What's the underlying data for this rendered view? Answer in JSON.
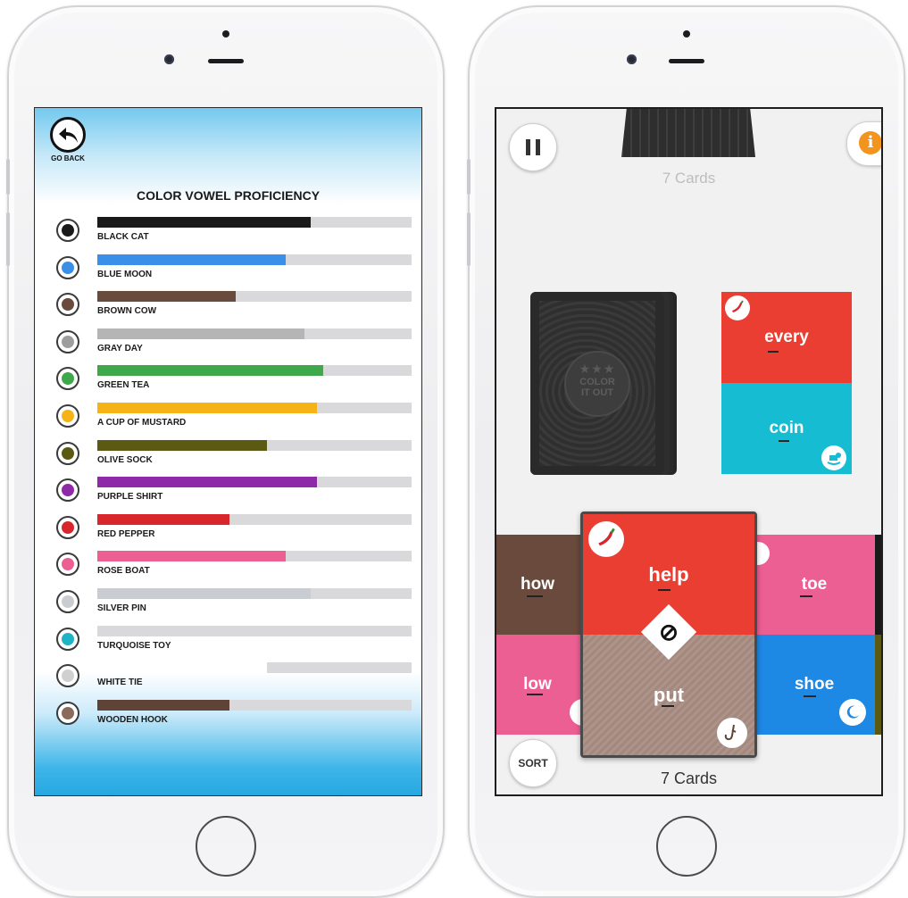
{
  "left_screen": {
    "go_back_label": "GO BACK",
    "title": "COLOR VOWEL PROFICIENCY",
    "rows": [
      {
        "label": "BLACK CAT",
        "color": "#1a1a1a",
        "icon_color": "#1a1a1a",
        "progress": 0.68,
        "icon": "cat-icon"
      },
      {
        "label": "BLUE MOON",
        "color": "#3a8fe8",
        "icon_color": "#3a8fe8",
        "progress": 0.6,
        "icon": "moon-icon"
      },
      {
        "label": "BROWN COW",
        "color": "#6a4a3c",
        "icon_color": "#6a4a3c",
        "progress": 0.44,
        "icon": "cow-icon"
      },
      {
        "label": "GRAY DAY",
        "color": "#b5b5b5",
        "icon_color": "#9e9e9e",
        "progress": 0.66,
        "icon": "cloud-icon"
      },
      {
        "label": "GREEN TEA",
        "color": "#3ea84a",
        "icon_color": "#3ea84a",
        "progress": 0.72,
        "icon": "teacup-icon"
      },
      {
        "label": "A CUP OF MUSTARD",
        "color": "#f5b316",
        "icon_color": "#f5b316",
        "progress": 0.7,
        "icon": "mustard-cup-icon"
      },
      {
        "label": "OLIVE SOCK",
        "color": "#5c5a12",
        "icon_color": "#5c5a12",
        "progress": 0.54,
        "icon": "sock-icon"
      },
      {
        "label": "PURPLE SHIRT",
        "color": "#8e2aa8",
        "icon_color": "#8e2aa8",
        "progress": 0.7,
        "icon": "shirt-icon"
      },
      {
        "label": "RED PEPPER",
        "color": "#d9262c",
        "icon_color": "#d9262c",
        "progress": 0.42,
        "icon": "pepper-icon"
      },
      {
        "label": "ROSE BOAT",
        "color": "#ec5f93",
        "icon_color": "#ec5f93",
        "progress": 0.6,
        "icon": "boat-icon"
      },
      {
        "label": "SILVER PIN",
        "color": "#c9ccd0",
        "icon_color": "#c9ccd0",
        "progress": 0.68,
        "icon": "pin-icon"
      },
      {
        "label": "TURQUOISE TOY",
        "color": "#c9ccd0",
        "icon_color": "#1fb3c8",
        "progress": 0.0,
        "icon": "rocking-horse-icon"
      },
      {
        "label": "WHITE TIE",
        "color": "#ffffff",
        "icon_color": "#d0d0d0",
        "progress": 0.54,
        "icon": "tie-icon"
      },
      {
        "label": "WOODEN HOOK",
        "color": "#5e4336",
        "icon_color": "#8b6a5c",
        "progress": 0.42,
        "icon": "hook-icon"
      }
    ]
  },
  "right_screen": {
    "top_count": "7 Cards",
    "bottom_count": "7 Cards",
    "sort_label": "SORT",
    "info_label": "i",
    "deck_text_line1": "COLOR",
    "deck_text_line2": "IT OUT",
    "deck_stars": "★★★",
    "played_card": {
      "top_word": "every",
      "bottom_word": "coin",
      "top_color": "#ea3e32",
      "bottom_color": "#15bcd2"
    },
    "hand_cards": [
      {
        "top_word": "how",
        "bottom_word": "low",
        "top_color": "#6a4a3c",
        "bottom_color": "#ec5f93"
      },
      {
        "top_word": "help",
        "bottom_word": "put",
        "top_color": "#ea3e32",
        "bottom_color": "#a88d83"
      },
      {
        "top_word": "toe",
        "bottom_word": "shoe",
        "top_color": "#ec5f93",
        "bottom_color": "#1e88e5"
      }
    ],
    "no_symbol": "⊘"
  }
}
